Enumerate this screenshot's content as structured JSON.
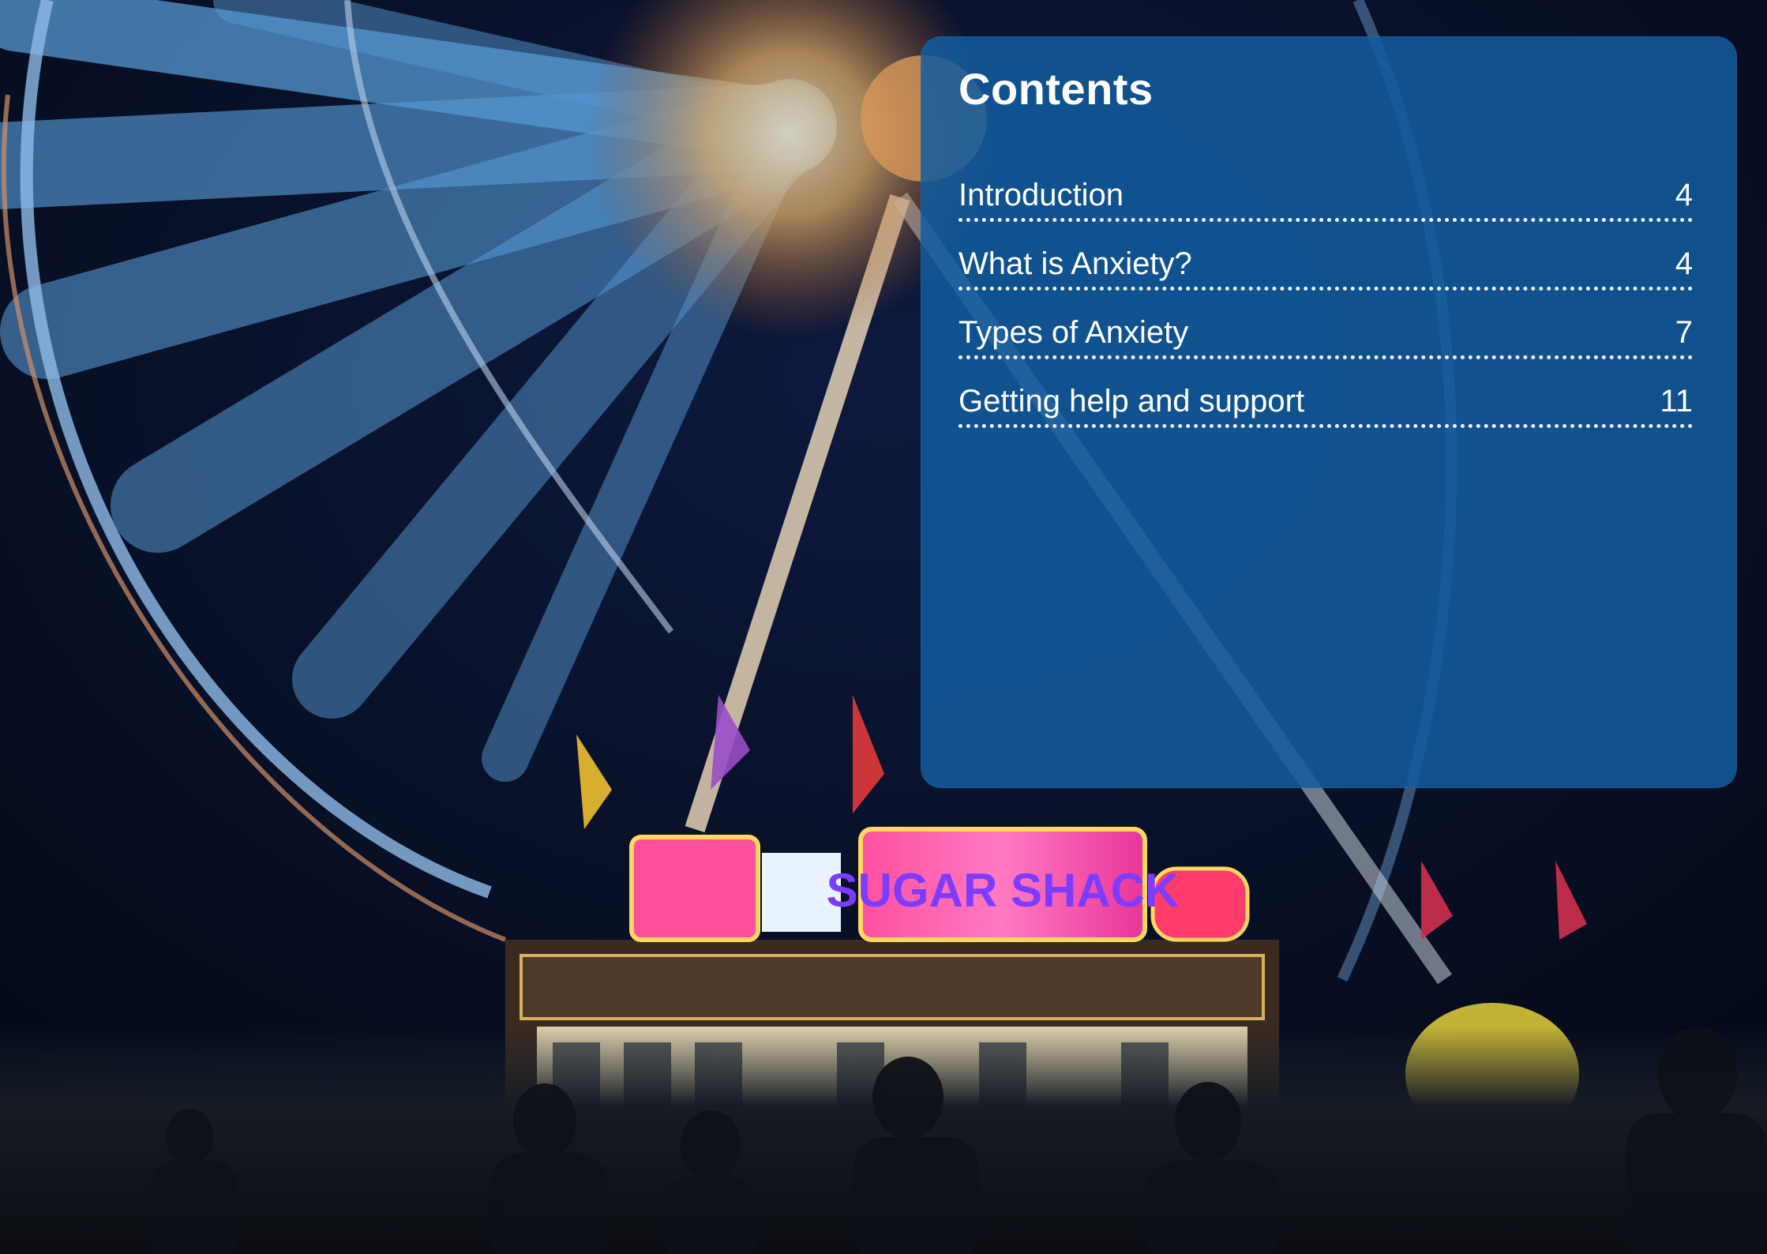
{
  "page": {
    "background_description_colors": {
      "night_sky": "#050a1e",
      "wheel_blue": "#5a9ed8",
      "wheel_glow": "#f3c98a",
      "panel_fill": "#125c9e"
    }
  },
  "contents": {
    "title": "Contents",
    "items": [
      {
        "label": "Introduction",
        "page": "4"
      },
      {
        "label": "What is Anxiety?",
        "page": "4"
      },
      {
        "label": "Types of Anxiety",
        "page": "7"
      },
      {
        "label": "Getting help and support",
        "page": "11"
      }
    ]
  },
  "stall_sign": {
    "main": "SUGAR SHACK"
  }
}
